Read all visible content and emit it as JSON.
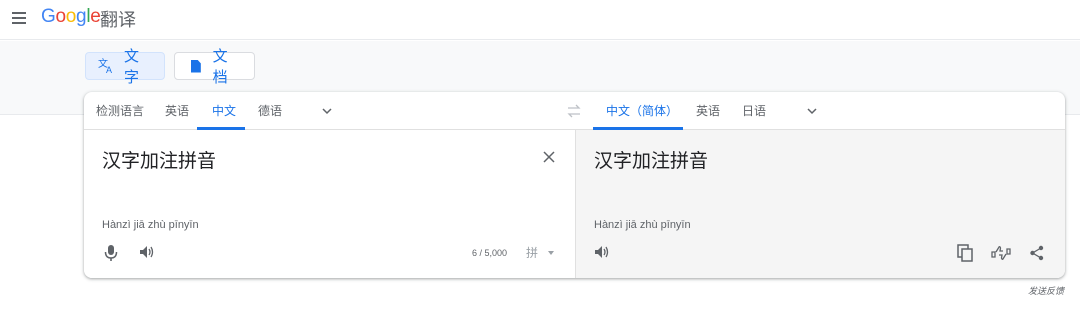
{
  "header": {
    "logo_letters": [
      "G",
      "o",
      "o",
      "g",
      "l",
      "e"
    ],
    "product_name": "翻译"
  },
  "modes": [
    {
      "label": "文字",
      "active": true
    },
    {
      "label": "文档",
      "active": false
    }
  ],
  "source_langs": [
    "检测语言",
    "英语",
    "中文",
    "德语"
  ],
  "source_active": "中文",
  "target_langs": [
    "中文（简体）",
    "英语",
    "日语"
  ],
  "target_active": "中文（简体）",
  "source": {
    "text": "汉字加注拼音",
    "transliteration": "Hànzì jiā zhù pīnyīn",
    "char_count": "6 / 5,000",
    "ime_label": "拼"
  },
  "target": {
    "text": "汉字加注拼音",
    "transliteration": "Hànzì jiā zhù pīnyīn"
  },
  "footer": {
    "feedback": "发送反馈"
  },
  "colors": {
    "accent": "#1a73e8",
    "target_pane_bg": "#f5f5f5"
  }
}
